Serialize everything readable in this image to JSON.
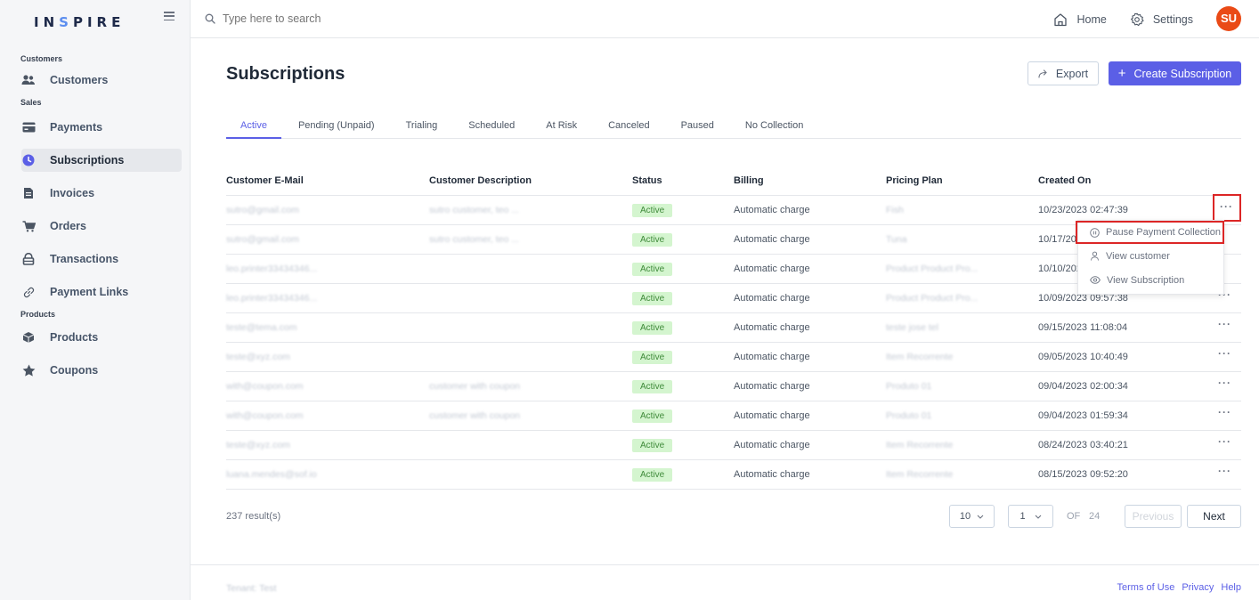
{
  "app": {
    "logo_main": "IN",
    "logo_accent": "S",
    "logo_rest": "PIRE"
  },
  "search": {
    "placeholder": "Type here to search"
  },
  "topbar": {
    "home_label": "Home",
    "settings_label": "Settings",
    "avatar_initials": "SU",
    "avatar_color": "#ea4a16"
  },
  "sidebar": {
    "sections": [
      {
        "label": "Customers"
      },
      {
        "label": "Sales"
      },
      {
        "label": "Products"
      }
    ],
    "items": [
      {
        "label": "Customers"
      },
      {
        "label": "Payments"
      },
      {
        "label": "Subscriptions"
      },
      {
        "label": "Invoices"
      },
      {
        "label": "Orders"
      },
      {
        "label": "Transactions"
      },
      {
        "label": "Payment Links"
      },
      {
        "label": "Products"
      },
      {
        "label": "Coupons"
      }
    ],
    "active_item": "Subscriptions"
  },
  "page": {
    "title": "Subscriptions",
    "export_label": "Export",
    "create_label": "Create Subscription",
    "accent_color": "#5b5fe6"
  },
  "tabs": [
    {
      "label": "Active"
    },
    {
      "label": "Pending (Unpaid)"
    },
    {
      "label": "Trialing"
    },
    {
      "label": "Scheduled"
    },
    {
      "label": "At Risk"
    },
    {
      "label": "Canceled"
    },
    {
      "label": "Paused"
    },
    {
      "label": "No Collection"
    }
  ],
  "table": {
    "headers": [
      "Customer E-Mail",
      "Customer Description",
      "Status",
      "Billing",
      "Pricing Plan",
      "Created On"
    ],
    "rows": [
      {
        "email": "sutro@gmail.com",
        "description": "sutro customer, teo ...",
        "status": "Active",
        "billing": "Automatic charge",
        "plan": "Fish",
        "created": "10/23/2023 02:47:39"
      },
      {
        "email": "sutro@gmail.com",
        "description": "sutro customer, teo ...",
        "status": "Active",
        "billing": "Automatic charge",
        "plan": "Tuna",
        "created": "10/17/2023 05:12:10"
      },
      {
        "email": "leo.printer33434346...",
        "description": "",
        "status": "Active",
        "billing": "Automatic charge",
        "plan": "Product Product Pro...",
        "created": "10/10/2023 02:11:45"
      },
      {
        "email": "leo.printer33434346...",
        "description": "",
        "status": "Active",
        "billing": "Automatic charge",
        "plan": "Product Product Pro...",
        "created": "10/09/2023 09:57:38"
      },
      {
        "email": "teste@tema.com",
        "description": "",
        "status": "Active",
        "billing": "Automatic charge",
        "plan": "teste jose tel",
        "created": "09/15/2023 11:08:04"
      },
      {
        "email": "teste@xyz.com",
        "description": "",
        "status": "Active",
        "billing": "Automatic charge",
        "plan": "Item Recorrente",
        "created": "09/05/2023 10:40:49"
      },
      {
        "email": "with@coupon.com",
        "description": "customer with coupon",
        "status": "Active",
        "billing": "Automatic charge",
        "plan": "Produto 01",
        "created": "09/04/2023 02:00:34"
      },
      {
        "email": "with@coupon.com",
        "description": "customer with coupon",
        "status": "Active",
        "billing": "Automatic charge",
        "plan": "Produto 01",
        "created": "09/04/2023 01:59:34"
      },
      {
        "email": "teste@xyz.com",
        "description": "",
        "status": "Active",
        "billing": "Automatic charge",
        "plan": "Item Recorrente",
        "created": "08/24/2023 03:40:21"
      },
      {
        "email": "luana.mendes@sof.io",
        "description": "",
        "status": "Active",
        "billing": "Automatic charge",
        "plan": "Item Recorrente",
        "created": "08/15/2023 09:52:20"
      }
    ]
  },
  "row_menu": {
    "items": [
      {
        "label": "Pause Payment Collection"
      },
      {
        "label": "View customer"
      },
      {
        "label": "View Subscription"
      }
    ]
  },
  "pagination": {
    "results": "237 result(s)",
    "page_size": "10",
    "current_page": "1",
    "of_label": "OF",
    "total_pages": "24",
    "previous_label": "Previous",
    "next_label": "Next"
  },
  "footer": {
    "tenant": "Tenant: Test",
    "links": [
      "Terms of Use",
      "Privacy",
      "Help"
    ]
  }
}
